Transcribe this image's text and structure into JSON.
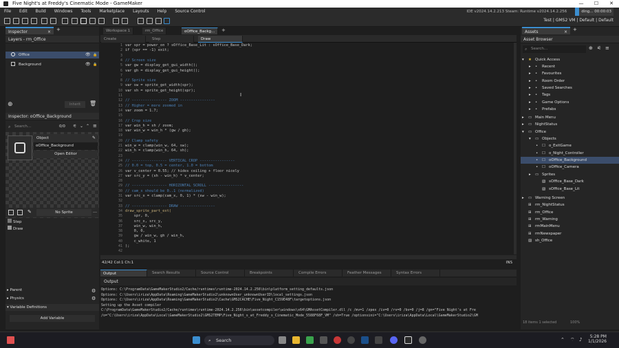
{
  "window": {
    "title": "Five Night's at Freddy's Cinematic Mode - GameMaker",
    "controls": [
      "—",
      "☐",
      "✕"
    ]
  },
  "menu": {
    "items": [
      "File",
      "Edit",
      "Build",
      "Windows",
      "Tools",
      "Marketplace",
      "Layouts",
      "Help",
      "Source Control"
    ],
    "ide_info": "IDE v2024.14.2.213 Steam: Runtime v2024.14.2.256",
    "timer": "ding... 00:00:03"
  },
  "toolbar": {
    "target": "Test | GMS2 VM | Default | Default"
  },
  "inspector": {
    "header": "Inspector",
    "layers_title": "Layers - rm_Office",
    "layers": [
      {
        "name": "Office"
      },
      {
        "name": "Background"
      }
    ],
    "inherit": "Inherit",
    "inspector_obj_title": "Inspector: oOffice_Background",
    "search_placeholder": "Search...",
    "search_count": "0/0",
    "object_label": "Object",
    "object_name": "oOffice_Background",
    "open_editor": "Open Editor",
    "no_sprite": "No Sprite",
    "events": [
      "Step",
      "Draw"
    ],
    "sections": [
      "Parent",
      "Physics",
      "Variable Definitions"
    ],
    "add_variable": "Add Variable"
  },
  "editor": {
    "workspace_tabs": [
      {
        "label": "Workspace 1"
      },
      {
        "label": "rm_Office"
      },
      {
        "label": "oOffice_Backg..."
      }
    ],
    "event_tabs": [
      {
        "label": "Create"
      },
      {
        "label": "Step"
      },
      {
        "label": "Draw"
      }
    ],
    "status_left": "42/42 Col:1 Ch:1",
    "status_right": "INS",
    "lines": [
      {
        "n": "1",
        "text": "var spr = power_on ? sOffice_Base_Lit : sOffice_Base_Dark;"
      },
      {
        "n": "2",
        "text": "if (spr == -1) exit;"
      },
      {
        "n": "3",
        "text": ""
      },
      {
        "n": "4",
        "text": "// Screen size"
      },
      {
        "n": "5",
        "text": "var gw = display_get_gui_width();"
      },
      {
        "n": "6",
        "text": "var gh = display_get_gui_height();"
      },
      {
        "n": "7",
        "text": ""
      },
      {
        "n": "8",
        "text": "// Sprite size"
      },
      {
        "n": "9",
        "text": "var sw = sprite_get_width(spr);"
      },
      {
        "n": "10",
        "text": "var sh = sprite_get_height(spr);"
      },
      {
        "n": "11",
        "text": ""
      },
      {
        "n": "12",
        "text": "// ---------------- ZOOM ----------------"
      },
      {
        "n": "13",
        "text": "// Higher = more zoomed in"
      },
      {
        "n": "14",
        "text": "var zoom = 1.7;"
      },
      {
        "n": "15",
        "text": ""
      },
      {
        "n": "16",
        "text": "// Crop size"
      },
      {
        "n": "17",
        "text": "var win_h = sh / zoom;"
      },
      {
        "n": "18",
        "text": "var win_w = win_h * (gw / gh);"
      },
      {
        "n": "19",
        "text": ""
      },
      {
        "n": "20",
        "text": "// Clamp safety"
      },
      {
        "n": "21",
        "text": "win_w = clamp(win_w, 64, sw);"
      },
      {
        "n": "22",
        "text": "win_h = clamp(win_h, 64, sh);"
      },
      {
        "n": "23",
        "text": ""
      },
      {
        "n": "24",
        "text": "// ---------------- VERTICAL CROP ----------------"
      },
      {
        "n": "25",
        "text": "// 0.0 = top, 0.5 = center, 1.0 = bottom"
      },
      {
        "n": "26",
        "text": "var v_center = 0.55; // hides ceiling + floor nicely"
      },
      {
        "n": "27",
        "text": "var src_y = (sh - win_h) * v_center;"
      },
      {
        "n": "28",
        "text": ""
      },
      {
        "n": "29",
        "text": "// ---------------- HORIZONTAL SCROLL ----------------"
      },
      {
        "n": "30",
        "text": "// cam_x should be 0..1 (normalized)"
      },
      {
        "n": "31",
        "text": "var src_x = clamp(cam_x, 0, 1) * (sw - win_w);"
      },
      {
        "n": "32",
        "text": ""
      },
      {
        "n": "33",
        "text": "// ---------------- DRAW ----------------"
      },
      {
        "n": "34",
        "text": "draw_sprite_part_ext("
      },
      {
        "n": "35",
        "text": "    spr, 0,"
      },
      {
        "n": "36",
        "text": "    src_x, src_y,"
      },
      {
        "n": "37",
        "text": "    win_w, win_h,"
      },
      {
        "n": "38",
        "text": "    0, 0,"
      },
      {
        "n": "39",
        "text": "    gw / win_w, gh / win_h,"
      },
      {
        "n": "40",
        "text": "    c_white, 1"
      },
      {
        "n": "41",
        "text": ");"
      },
      {
        "n": "42",
        "text": ""
      }
    ]
  },
  "output": {
    "tabs": [
      {
        "label": "Output"
      },
      {
        "label": "Search Results"
      },
      {
        "label": "Source Control"
      },
      {
        "label": "Breakpoints"
      },
      {
        "label": "Compile Errors"
      },
      {
        "label": "Feather Messages"
      },
      {
        "label": "Syntax Errors"
      }
    ],
    "sub_label": "Output",
    "lines": [
      "Options: C:\\ProgramData\\GameMakerStudio2/Cache/runtimes\\runtime-2024.14.2.256\\bin\\platform_setting_defaults.json",
      "Options: C:\\Users\\iriza\\AppData\\Roaming\\GameMakerStudio2\\unknownUser_unknownUserID\\local_settings.json",
      "Options: C:\\Users\\iriza\\AppData\\Roaming\\GameMakerStudio2\\Cache\\GMS2CACHE\\Five_Night_C159E48F\\targetoptions.json",
      "Setting up the Asset compiler",
      "C:\\ProgramData\\GameMakerStudio2/Cache/runtimes\\runtime-2024.14.2.256\\bin\\assetcompiler\\windows\\x64\\GMAssetCompiler.dll  /c /mv=1 /zpex /iv=0 /rv=0 /bv=0 /j=8  /gn=\"Five Night's at Fre",
      "/o=\"C:\\Users\\iriza\\AppData\\Local\\GameMakerStudio2\\GMS2TEMP\\Five_Night_s_at_Freddy_s_Cinematic_Mode_5588F68F_VM\" /sh=True /optionsini=\"C:\\Users\\iriza\\AppData\\Local\\GameMakerStudio2\\GM"
    ]
  },
  "assets": {
    "header": "Assets",
    "browser_title": "Asset Browser",
    "search_placeholder": "Search...",
    "quick_access": "Quick Access",
    "quick_items": [
      "Recent",
      "Favourites",
      "Room Order",
      "Saved Searches",
      "Tags",
      "Game Options",
      "Prefabs"
    ],
    "tree": [
      {
        "label": "Main Menu"
      },
      {
        "label": "NightStatus"
      },
      {
        "label": "Office"
      },
      {
        "label": "Objects"
      },
      {
        "label": "o_ExitGame"
      },
      {
        "label": "o_Night_Controller"
      },
      {
        "label": "oOffice_Background"
      },
      {
        "label": "oOffice_Camera"
      },
      {
        "label": "Sprites"
      },
      {
        "label": "sOffice_Base_Dark"
      },
      {
        "label": "sOffice_Base_Lit"
      },
      {
        "label": "Warning Screen"
      },
      {
        "label": "rm_NightStatus"
      },
      {
        "label": "rm_Office"
      },
      {
        "label": "rm_Warning"
      },
      {
        "label": "rmMainMenu"
      },
      {
        "label": "rmNewspaper"
      },
      {
        "label": "sh_Office"
      }
    ],
    "footer_left": "18 items   1 selected",
    "footer_right": "100%"
  },
  "taskbar": {
    "search": "Search",
    "time": "5:28 PM",
    "date": "1/1/2026"
  }
}
